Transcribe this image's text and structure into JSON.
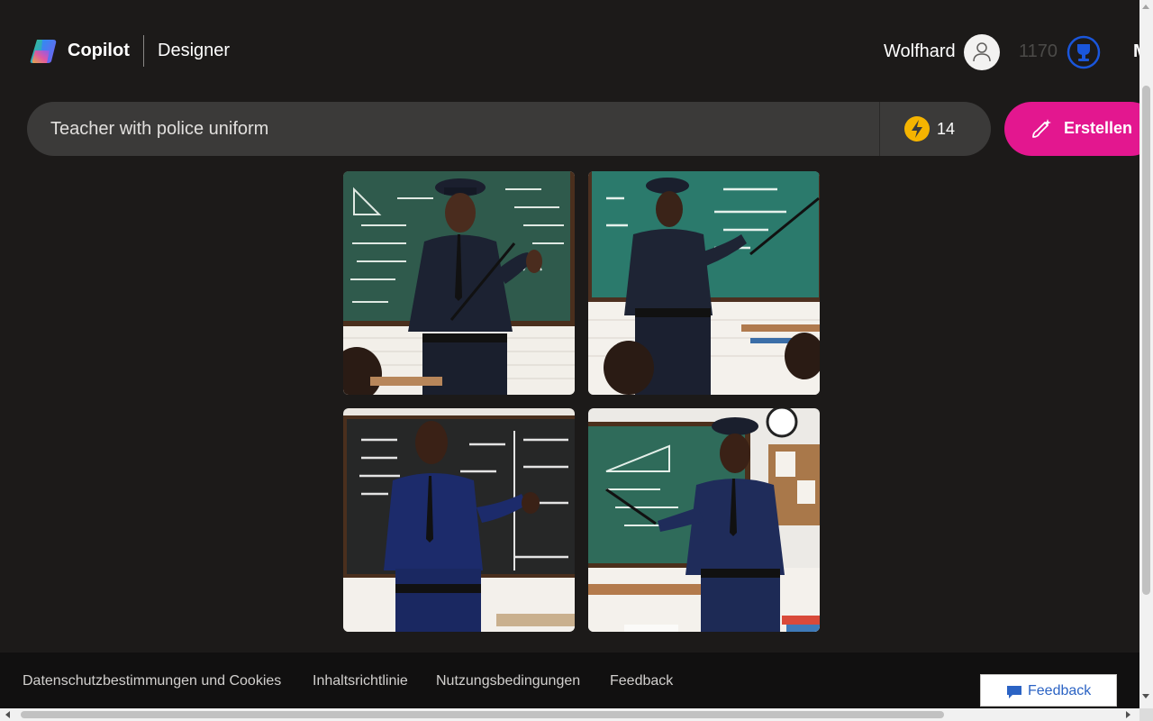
{
  "header": {
    "brand": "Copilot",
    "product": "Designer",
    "user_name": "Wolfhard",
    "points": "1170",
    "more_menu_letter": "M"
  },
  "prompt": {
    "value": "Teacher with police uniform",
    "boost_count": "14",
    "create_label": "Erstellen"
  },
  "gallery": {
    "images": [
      {
        "board": "chalkboard-green"
      },
      {
        "board": "chalkboard-green"
      },
      {
        "board": "chalkboard-black"
      },
      {
        "board": "chalkboard-green"
      }
    ]
  },
  "footer": {
    "links": [
      "Datenschutzbestimmungen und Cookies",
      "Inhaltsrichtlinie",
      "Nutzungsbedingungen",
      "Feedback"
    ],
    "feedback_button": "Feedback"
  },
  "colors": {
    "background": "#1c1a19",
    "prompt_bar": "#3b3a39",
    "create_button": "#e3178f",
    "boost_icon": "#f5b400",
    "reward_icon": "#1a56db",
    "feedback_text": "#2b63c4"
  },
  "icons": {
    "logo": "copilot-logo-icon",
    "avatar": "user-icon",
    "reward": "trophy-icon",
    "boost": "lightning-icon",
    "create": "brush-sparkle-icon",
    "feedback": "chat-bubble-icon"
  }
}
